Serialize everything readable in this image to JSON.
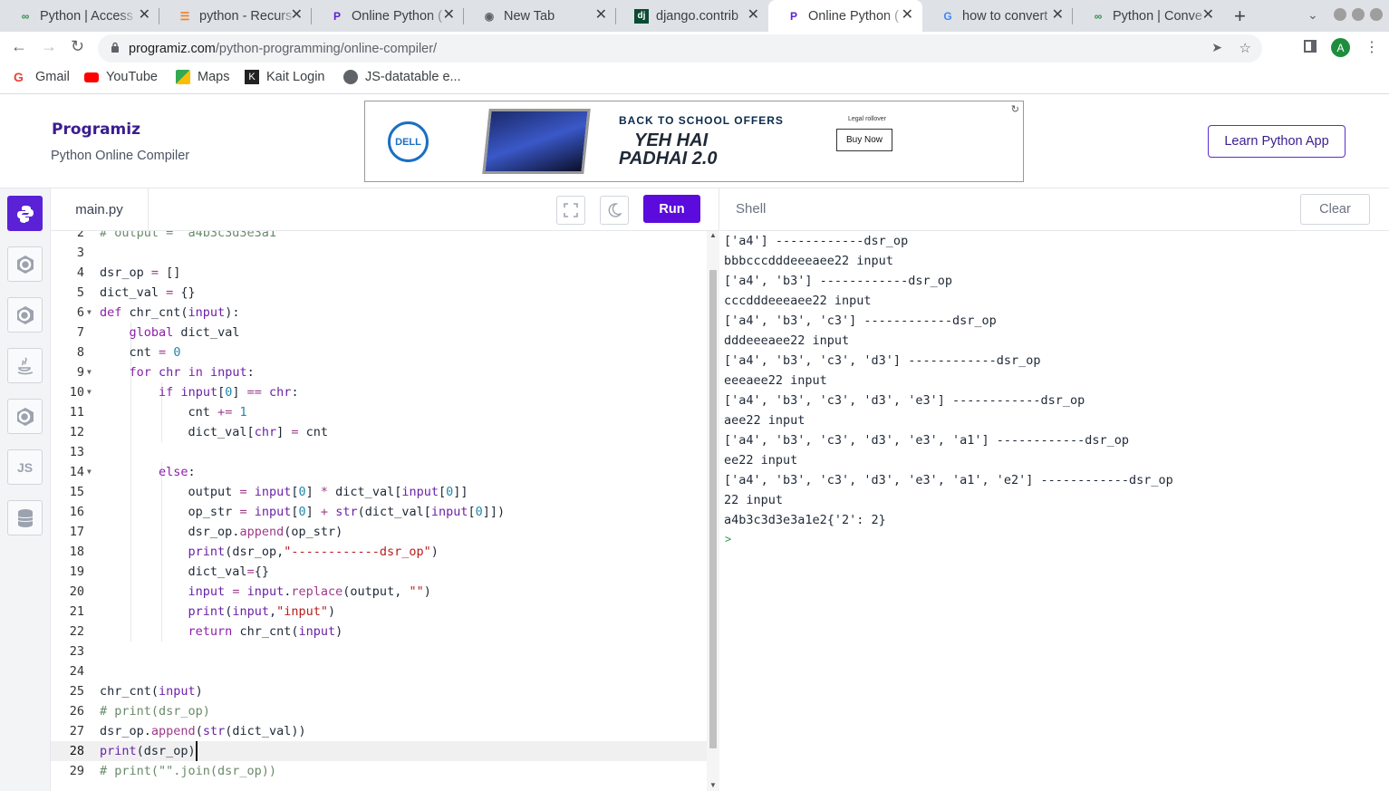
{
  "browser": {
    "tabs": [
      {
        "title": "Python | Access",
        "favicon": "gfg-icon"
      },
      {
        "title": "python - Recurs",
        "favicon": "stackoverflow-icon"
      },
      {
        "title": "Online Python (",
        "favicon": "programiz-icon"
      },
      {
        "title": "New Tab",
        "favicon": "chrome-icon"
      },
      {
        "title": "django.contrib",
        "favicon": "django-icon"
      },
      {
        "title": "Online Python (",
        "favicon": "programiz-icon",
        "active": true
      },
      {
        "title": "how to convert",
        "favicon": "google-icon"
      },
      {
        "title": "Python | Conve",
        "favicon": "gfg-icon"
      }
    ],
    "url_host": "programiz.com",
    "url_path": "/python-programming/online-compiler/",
    "profile_initial": "A",
    "bookmarks": [
      "Gmail",
      "YouTube",
      "Maps",
      "Kait Login",
      "JS-datatable e..."
    ]
  },
  "header": {
    "logo": "Programiz",
    "subtitle": "Python Online Compiler",
    "learn_button": "Learn Python App"
  },
  "ad": {
    "brand": "DELL",
    "headline": "BACK TO SCHOOL OFFERS",
    "tagline_1": "YEH HAI",
    "tagline_2": "PADHAI 2.0",
    "legal": "Legal rollover",
    "cta": "Buy Now"
  },
  "editor": {
    "filename": "main.py",
    "run_label": "Run",
    "current_line": 28,
    "lines": [
      {
        "n": 2,
        "text": "# output = \"a4b3c3d3e3a1\""
      },
      {
        "n": 3,
        "text": ""
      },
      {
        "n": 4,
        "text": "dsr_op = []"
      },
      {
        "n": 5,
        "text": "dict_val = {}"
      },
      {
        "n": 6,
        "text": "def chr_cnt(input):"
      },
      {
        "n": 7,
        "text": "    global dict_val"
      },
      {
        "n": 8,
        "text": "    cnt = 0"
      },
      {
        "n": 9,
        "text": "    for chr in input:"
      },
      {
        "n": 10,
        "text": "        if input[0] == chr:"
      },
      {
        "n": 11,
        "text": "            cnt += 1"
      },
      {
        "n": 12,
        "text": "            dict_val[chr] = cnt"
      },
      {
        "n": 13,
        "text": ""
      },
      {
        "n": 14,
        "text": "        else:"
      },
      {
        "n": 15,
        "text": "            output = input[0] * dict_val[input[0]]"
      },
      {
        "n": 16,
        "text": "            op_str = input[0] + str(dict_val[input[0]])"
      },
      {
        "n": 17,
        "text": "            dsr_op.append(op_str)"
      },
      {
        "n": 18,
        "text": "            print(dsr_op,\"------------dsr_op\")"
      },
      {
        "n": 19,
        "text": "            dict_val={}"
      },
      {
        "n": 20,
        "text": "            input = input.replace(output, \"\")"
      },
      {
        "n": 21,
        "text": "            print(input,\"input\")"
      },
      {
        "n": 22,
        "text": "            return chr_cnt(input)"
      },
      {
        "n": 23,
        "text": ""
      },
      {
        "n": 24,
        "text": ""
      },
      {
        "n": 25,
        "text": "chr_cnt(input)"
      },
      {
        "n": 26,
        "text": "# print(dsr_op)"
      },
      {
        "n": 27,
        "text": "dsr_op.append(str(dict_val))"
      },
      {
        "n": 28,
        "text": "print(dsr_op)"
      },
      {
        "n": 29,
        "text": "# print(\"\".join(dsr_op))"
      }
    ]
  },
  "shell": {
    "title": "Shell",
    "clear_label": "Clear",
    "prompt": ">",
    "lines": [
      "['a4'] ------------dsr_op",
      "bbbcccdddeeeaee22 input",
      "['a4', 'b3'] ------------dsr_op",
      "cccdddeeeaee22 input",
      "['a4', 'b3', 'c3'] ------------dsr_op",
      "dddeeeaee22 input",
      "['a4', 'b3', 'c3', 'd3'] ------------dsr_op",
      "eeeaee22 input",
      "['a4', 'b3', 'c3', 'd3', 'e3'] ------------dsr_op",
      "aee22 input",
      "['a4', 'b3', 'c3', 'd3', 'e3', 'a1'] ------------dsr_op",
      "ee22 input",
      "['a4', 'b3', 'c3', 'd3', 'e3', 'a1', 'e2'] ------------dsr_op",
      "22 input",
      "a4b3c3d3e3a1e2{'2': 2}"
    ]
  },
  "sidebar": {
    "languages": [
      "python-icon",
      "c-icon",
      "cpp-icon",
      "java-icon",
      "csharp-icon",
      "js-icon",
      "sql-icon"
    ],
    "js_label": "JS"
  }
}
